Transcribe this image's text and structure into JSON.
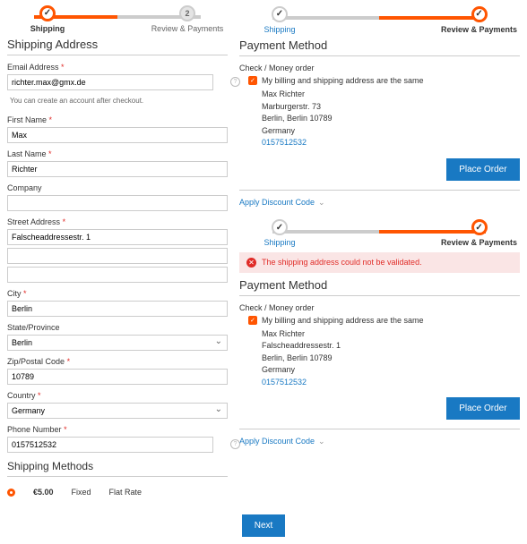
{
  "steps": {
    "s1": "Shipping",
    "s2": "Review & Payments",
    "num2": "2"
  },
  "left": {
    "title": "Shipping Address",
    "email_lbl": "Email Address",
    "email_val": "richter.max@gmx.de",
    "email_note": "You can create an account after checkout.",
    "fn_lbl": "First Name",
    "fn_val": "Max",
    "ln_lbl": "Last Name",
    "ln_val": "Richter",
    "co_lbl": "Company",
    "co_val": "",
    "sa_lbl": "Street Address",
    "sa_val": "Falscheaddressestr. 1",
    "city_lbl": "City",
    "city_val": "Berlin",
    "sp_lbl": "State/Province",
    "sp_val": "Berlin",
    "zip_lbl": "Zip/Postal Code",
    "zip_val": "10789",
    "ct_lbl": "Country",
    "ct_val": "Germany",
    "ph_lbl": "Phone Number",
    "ph_val": "0157512532",
    "sm_title": "Shipping Methods",
    "sm_price": "€5.00",
    "sm_col1": "Fixed",
    "sm_col2": "Flat Rate",
    "next": "Next"
  },
  "p1": {
    "title": "Payment Method",
    "sub": "Check / Money order",
    "cb": "My billing and shipping address are the same",
    "a1": "Max Richter",
    "a2": "Marburgerstr. 73",
    "a3": "Berlin, Berlin 10789",
    "a4": "Germany",
    "a5": "0157512532",
    "btn": "Place Order",
    "disc": "Apply Discount Code"
  },
  "p2": {
    "err": "The shipping address could not be validated.",
    "title": "Payment Method",
    "sub": "Check / Money order",
    "cb": "My billing and shipping address are the same",
    "a1": "Max Richter",
    "a2": "Falscheaddressestr. 1",
    "a3": "Berlin, Berlin 10789",
    "a4": "Germany",
    "a5": "0157512532",
    "btn": "Place Order",
    "disc": "Apply Discount Code"
  }
}
